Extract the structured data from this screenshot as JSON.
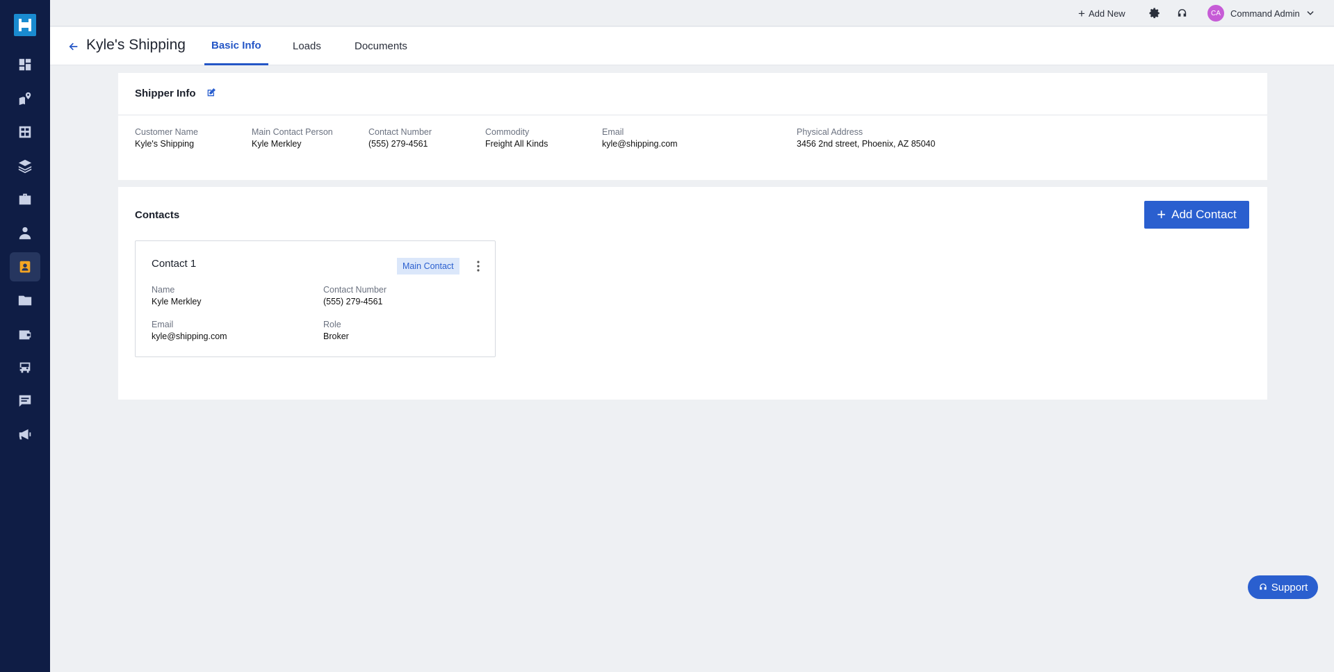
{
  "topbar": {
    "add_new_label": "Add New",
    "avatar_initials": "CA",
    "user_name": "Command Admin"
  },
  "header": {
    "title": "Kyle's Shipping",
    "tabs": [
      {
        "label": "Basic Info",
        "active": true
      },
      {
        "label": "Loads",
        "active": false
      },
      {
        "label": "Documents",
        "active": false
      }
    ]
  },
  "shipper_info": {
    "title": "Shipper Info",
    "fields": [
      {
        "label": "Customer Name",
        "value": "Kyle's Shipping"
      },
      {
        "label": "Main Contact Person",
        "value": "Kyle Merkley"
      },
      {
        "label": "Contact Number",
        "value": "(555) 279-4561"
      },
      {
        "label": "Commodity",
        "value": "Freight All Kinds"
      },
      {
        "label": "Email",
        "value": "kyle@shipping.com"
      },
      {
        "label": "Physical Address",
        "value": "3456 2nd street, Phoenix, AZ 85040"
      }
    ]
  },
  "contacts": {
    "title": "Contacts",
    "add_button_label": "Add Contact",
    "items": [
      {
        "title": "Contact 1",
        "badge": "Main Contact",
        "name_label": "Name",
        "name": "Kyle Merkley",
        "number_label": "Contact Number",
        "number": "(555) 279-4561",
        "email_label": "Email",
        "email": "kyle@shipping.com",
        "role_label": "Role",
        "role": "Broker"
      }
    ]
  },
  "support": {
    "label": "Support"
  },
  "colors": {
    "sidebar": "#0f1d45",
    "accent": "#2a5fcf",
    "active_nav": "#f5a623",
    "logo": "#1a8bd0"
  }
}
